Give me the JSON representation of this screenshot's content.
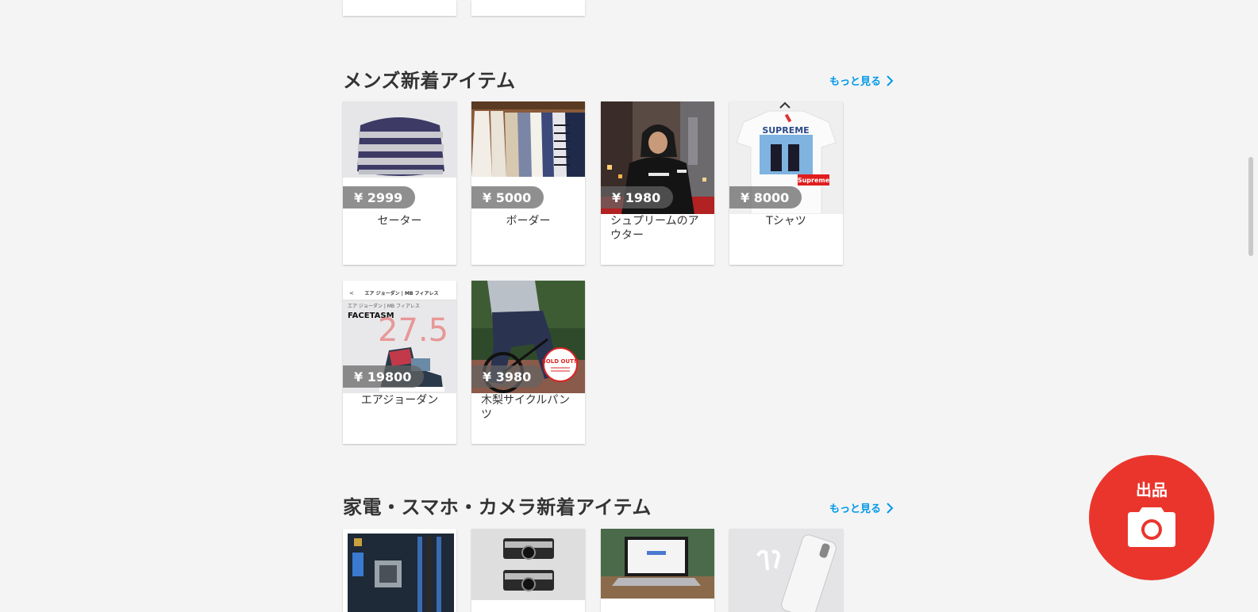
{
  "more_label": "もっと見る",
  "sections": [
    {
      "title": "メンズ新着アイテム",
      "items": [
        {
          "price": "¥ 2999",
          "name": "セーター"
        },
        {
          "price": "¥ 5000",
          "name": "ボーダー"
        },
        {
          "price": "¥ 1980",
          "name": "シュプリームのアウター"
        },
        {
          "price": "¥ 8000",
          "name": "Tシャツ"
        },
        {
          "price": "¥ 19800",
          "name": "エアジョーダン"
        },
        {
          "price": "¥ 3980",
          "name": "木梨サイクルパンツ"
        }
      ]
    },
    {
      "title": "家電・スマホ・カメラ新着アイテム"
    }
  ],
  "image_text": {
    "supreme_print": "SUPREME",
    "supreme_logo": "Supreme",
    "app_bar_title": "エア ジョーダン | MB フィアレス",
    "app_subtitle": "エア ジョーダン | MB フィアレス",
    "brand": "FACETASM",
    "handwritten": "27.5",
    "sold_out": "SOLD OUT!!"
  },
  "sell_button": {
    "label": "出品",
    "icon": "camera-icon"
  },
  "colors": {
    "accent": "#ea352d",
    "link": "#0099e8",
    "background": "#f4f4f4"
  }
}
